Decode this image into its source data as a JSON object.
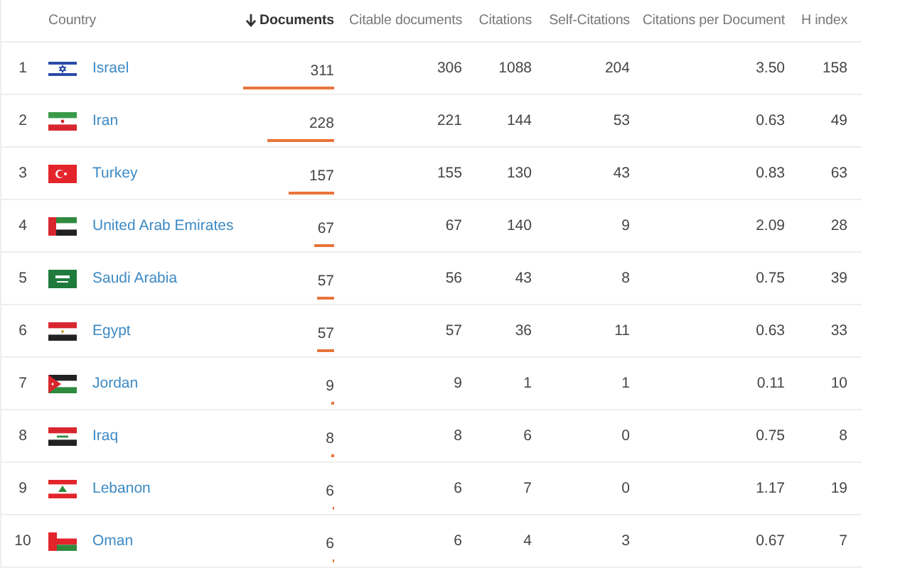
{
  "columns": [
    {
      "label": "Country",
      "sorted": false
    },
    {
      "label": "Documents",
      "sorted": true
    },
    {
      "label": "Citable documents",
      "sorted": false
    },
    {
      "label": "Citations",
      "sorted": false
    },
    {
      "label": "Self-Citations",
      "sorted": false
    },
    {
      "label": "Citations per Document",
      "sorted": false
    },
    {
      "label": "H index",
      "sorted": false
    }
  ],
  "rows": [
    {
      "rank": "1",
      "country": "Israel",
      "documents": "311",
      "citable_documents": "306",
      "citations": "1088",
      "self_citations": "204",
      "citations_per_document": "3.50",
      "h_index": "158"
    },
    {
      "rank": "2",
      "country": "Iran",
      "documents": "228",
      "citable_documents": "221",
      "citations": "144",
      "self_citations": "53",
      "citations_per_document": "0.63",
      "h_index": "49"
    },
    {
      "rank": "3",
      "country": "Turkey",
      "documents": "157",
      "citable_documents": "155",
      "citations": "130",
      "self_citations": "43",
      "citations_per_document": "0.83",
      "h_index": "63"
    },
    {
      "rank": "4",
      "country": "United Arab Emirates",
      "documents": "67",
      "citable_documents": "67",
      "citations": "140",
      "self_citations": "9",
      "citations_per_document": "2.09",
      "h_index": "28"
    },
    {
      "rank": "5",
      "country": "Saudi Arabia",
      "documents": "57",
      "citable_documents": "56",
      "citations": "43",
      "self_citations": "8",
      "citations_per_document": "0.75",
      "h_index": "39"
    },
    {
      "rank": "6",
      "country": "Egypt",
      "documents": "57",
      "citable_documents": "57",
      "citations": "36",
      "self_citations": "11",
      "citations_per_document": "0.63",
      "h_index": "33"
    },
    {
      "rank": "7",
      "country": "Jordan",
      "documents": "9",
      "citable_documents": "9",
      "citations": "1",
      "self_citations": "1",
      "citations_per_document": "0.11",
      "h_index": "10"
    },
    {
      "rank": "8",
      "country": "Iraq",
      "documents": "8",
      "citable_documents": "8",
      "citations": "6",
      "self_citations": "0",
      "citations_per_document": "0.75",
      "h_index": "8"
    },
    {
      "rank": "9",
      "country": "Lebanon",
      "documents": "6",
      "citable_documents": "6",
      "citations": "7",
      "self_citations": "0",
      "citations_per_document": "1.17",
      "h_index": "19"
    },
    {
      "rank": "10",
      "country": "Oman",
      "documents": "6",
      "citable_documents": "6",
      "citations": "4",
      "self_citations": "3",
      "citations_per_document": "0.67",
      "h_index": "7"
    }
  ]
}
